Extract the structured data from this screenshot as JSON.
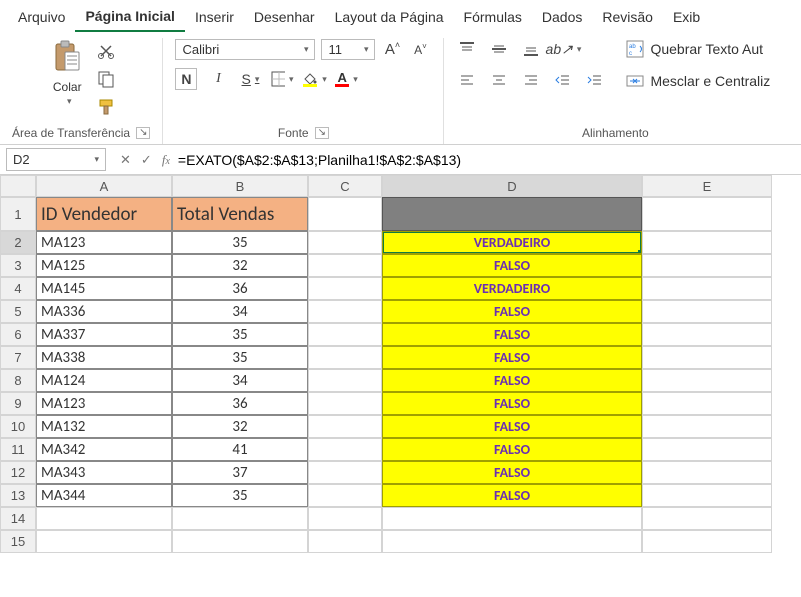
{
  "menu": {
    "items": [
      "Arquivo",
      "Página Inicial",
      "Inserir",
      "Desenhar",
      "Layout da Página",
      "Fórmulas",
      "Dados",
      "Revisão",
      "Exib"
    ],
    "active_index": 1
  },
  "ribbon": {
    "clipboard": {
      "paste": "Colar",
      "label": "Área de Transferência"
    },
    "font": {
      "name": "Calibri",
      "size": "11",
      "bold": "N",
      "italic": "I",
      "underline": "S",
      "label": "Fonte"
    },
    "alignment": {
      "label": "Alinhamento",
      "wrap": "Quebrar Texto Aut",
      "merge": "Mesclar e Centraliz"
    }
  },
  "namebox": "D2",
  "formula": "=EXATO($A$2:$A$13;Planilha1!$A$2:$A$13)",
  "columns": [
    "A",
    "B",
    "C",
    "D",
    "E"
  ],
  "headers": {
    "A": "ID Vendedor",
    "B": "Total Vendas"
  },
  "rows": [
    {
      "id": "MA123",
      "total": "35",
      "d": "VERDADEIRO"
    },
    {
      "id": "MA125",
      "total": "32",
      "d": "FALSO"
    },
    {
      "id": "MA145",
      "total": "36",
      "d": "VERDADEIRO"
    },
    {
      "id": "MA336",
      "total": "34",
      "d": "FALSO"
    },
    {
      "id": "MA337",
      "total": "35",
      "d": "FALSO"
    },
    {
      "id": "MA338",
      "total": "35",
      "d": "FALSO"
    },
    {
      "id": "MA124",
      "total": "34",
      "d": "FALSO"
    },
    {
      "id": "MA123",
      "total": "36",
      "d": "FALSO"
    },
    {
      "id": "MA132",
      "total": "32",
      "d": "FALSO"
    },
    {
      "id": "MA342",
      "total": "41",
      "d": "FALSO"
    },
    {
      "id": "MA343",
      "total": "37",
      "d": "FALSO"
    },
    {
      "id": "MA344",
      "total": "35",
      "d": "FALSO"
    }
  ],
  "extra_rows": [
    "14",
    "15"
  ]
}
